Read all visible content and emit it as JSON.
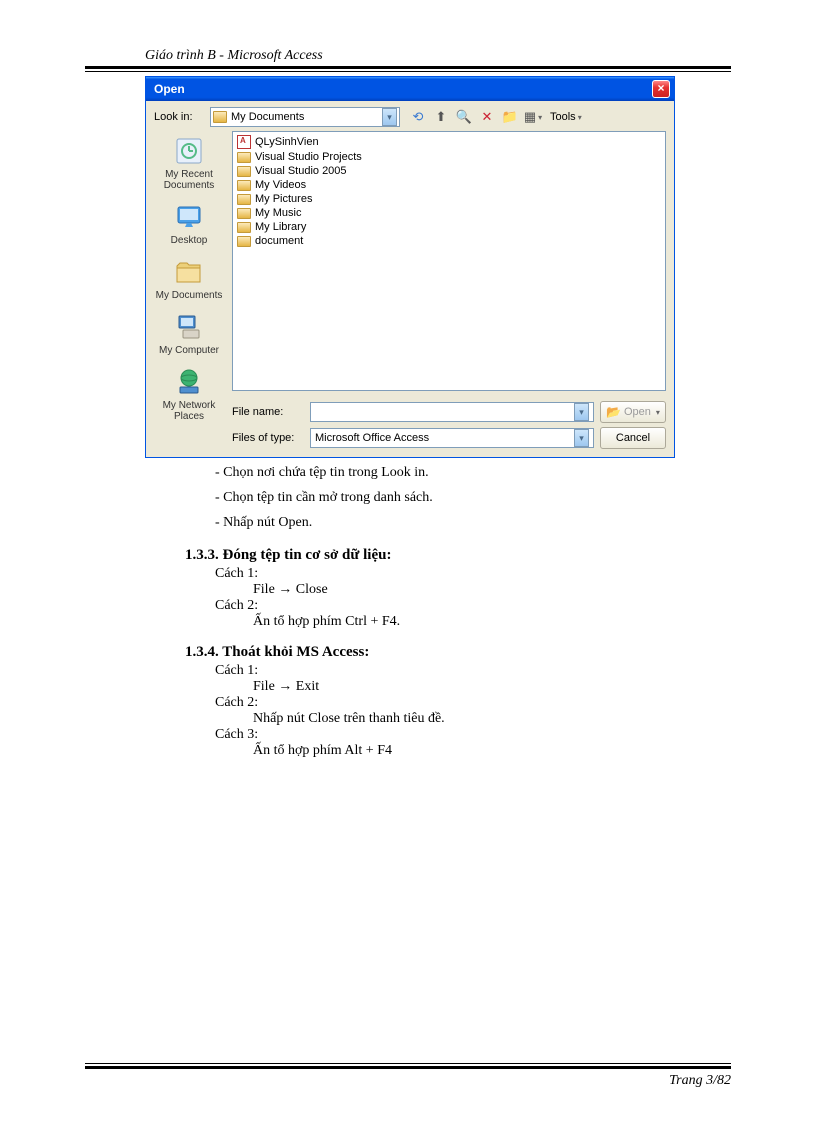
{
  "page_header": "Giáo trình B - Microsoft Access",
  "page_footer": "Trang 3/82",
  "dialog": {
    "title": "Open",
    "lookin_label": "Look in:",
    "lookin_value": "My Documents",
    "tools_label": "Tools",
    "places": [
      {
        "label": "My Recent Documents"
      },
      {
        "label": "Desktop"
      },
      {
        "label": "My Documents"
      },
      {
        "label": "My Computer"
      },
      {
        "label": "My Network Places"
      }
    ],
    "files": [
      {
        "name": "QLySinhVien",
        "type": "access"
      },
      {
        "name": "Visual Studio Projects",
        "type": "folder"
      },
      {
        "name": "Visual Studio 2005",
        "type": "folder"
      },
      {
        "name": "My Videos",
        "type": "folder"
      },
      {
        "name": "My Pictures",
        "type": "folder"
      },
      {
        "name": "My Music",
        "type": "folder"
      },
      {
        "name": "My Library",
        "type": "folder"
      },
      {
        "name": "document",
        "type": "folder"
      }
    ],
    "filename_label": "File name:",
    "filename_value": "",
    "filetype_label": "Files of type:",
    "filetype_value": "Microsoft Office Access",
    "open_btn": "Open",
    "cancel_btn": "Cancel"
  },
  "steps": {
    "s1": "- Chọn nơi chứa tệp tin trong Look in.",
    "s2": "- Chọn tệp tin cần mở trong danh sách.",
    "s3": "- Nhấp nút Open."
  },
  "h133": "1.3.3.  Đóng tệp tin cơ sở dữ liệu:",
  "h133_c1": "Cách 1:",
  "h133_c1_b": "File → Close",
  "h133_c2": "Cách 2:",
  "h133_c2_b": "Ấn tổ hợp phím Ctrl + F4.",
  "h134": "1.3.4.  Thoát khỏi MS Access:",
  "h134_c1": "Cách 1:",
  "h134_c1_b": "File → Exit",
  "h134_c2": "Cách 2:",
  "h134_c2_b": "Nhấp nút Close trên thanh tiêu đề.",
  "h134_c3": "Cách 3:",
  "h134_c3_b": "Ấn tổ hợp phím Alt + F4"
}
